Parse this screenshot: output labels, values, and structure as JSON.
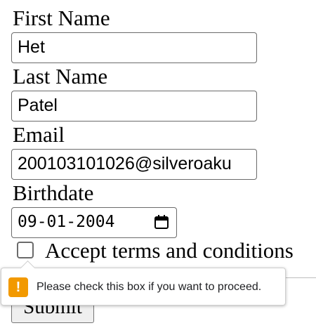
{
  "form": {
    "first_name": {
      "label": "First Name",
      "value": "Het"
    },
    "last_name": {
      "label": "Last Name",
      "value": "Patel"
    },
    "email": {
      "label": "Email",
      "value": "200103101026@silveroaku"
    },
    "birthdate": {
      "label": "Birthdate",
      "value": "09-01-2004",
      "icon": "calendar-icon"
    },
    "terms": {
      "label": "Accept terms and conditions",
      "checked": false
    },
    "submit_label": "Submit"
  },
  "validation_tooltip": {
    "icon": "warning-icon",
    "icon_color": "#f29900",
    "message": "Please check this box if you want to proceed."
  }
}
